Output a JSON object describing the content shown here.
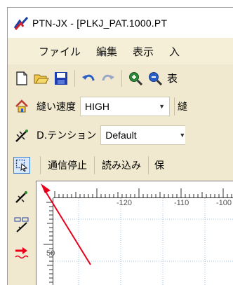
{
  "window": {
    "title": "PTN-JX - [PLKJ_PAT.1000.PT"
  },
  "menu": [
    "ファイル",
    "編集",
    "表示",
    "入"
  ],
  "toolbar": {
    "trailing_text": "表"
  },
  "speed_row": {
    "label": "縫い速度",
    "value": "HIGH",
    "trailing_label": "縫"
  },
  "tension_row": {
    "label": "D.テンション",
    "value": "Default"
  },
  "command_row": {
    "buttons": [
      "通信停止",
      "読み込み",
      "保"
    ]
  },
  "ruler": {
    "x_labels": [
      "-120",
      "-110",
      "-100"
    ],
    "y_labels": [
      "50"
    ]
  },
  "colors": {
    "accent_red": "#e8001a",
    "selected_border": "#3b7fd1"
  },
  "icons": [
    "app-logo-icon",
    "new-file-icon",
    "open-folder-icon",
    "save-icon",
    "undo-icon",
    "redo-icon",
    "zoom-in-icon",
    "zoom-out-icon",
    "home-icon",
    "stitch-tool-icon",
    "select-rect-icon",
    "line-tool-icon",
    "pattern-tool-icon",
    "arrow-tool-icon"
  ]
}
